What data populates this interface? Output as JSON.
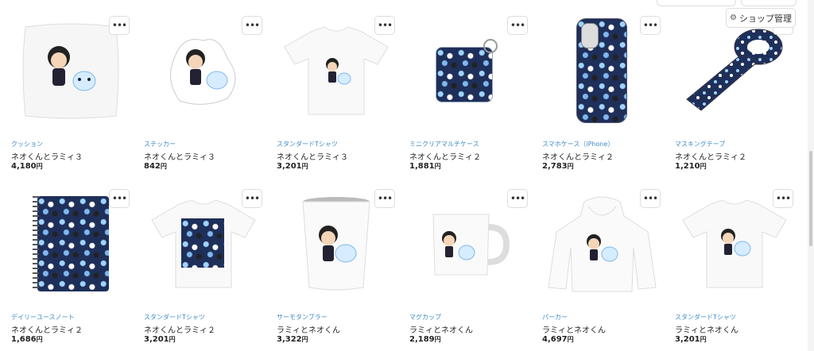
{
  "header": {
    "shop_manage_label": "ショップ管理",
    "shop_manage_icon": "gear-icon"
  },
  "products": [
    {
      "category": "クッション",
      "name": "ネオくんとラミィ３",
      "price": "4,180",
      "currency": "円"
    },
    {
      "category": "ステッカー",
      "name": "ネオくんとラミィ３",
      "price": "842",
      "currency": "円"
    },
    {
      "category": "スタンダードTシャツ",
      "name": "ネオくんとラミィ３",
      "price": "3,201",
      "currency": "円"
    },
    {
      "category": "ミニクリアマルチケース",
      "name": "ネオくんとラミィ２",
      "price": "1,881",
      "currency": "円"
    },
    {
      "category": "スマホケース（iPhone）",
      "name": "ネオくんとラミィ２",
      "price": "2,783",
      "currency": "円"
    },
    {
      "category": "マスキングテープ",
      "name": "ネオくんとラミィ２",
      "price": "1,210",
      "currency": "円"
    },
    {
      "category": "デイリーユースノート",
      "name": "ネオくんとラミィ２",
      "price": "1,686",
      "currency": "円"
    },
    {
      "category": "スタンダードTシャツ",
      "name": "ネオくんとラミィ２",
      "price": "3,201",
      "currency": "円"
    },
    {
      "category": "サーモタンブラー",
      "name": "ラミィとネオくん",
      "price": "3,322",
      "currency": "円"
    },
    {
      "category": "マグカップ",
      "name": "ラミィとネオくん",
      "price": "2,189",
      "currency": "円"
    },
    {
      "category": "パーカー",
      "name": "ラミィとネオくん",
      "price": "4,697",
      "currency": "円"
    },
    {
      "category": "スタンダードTシャツ",
      "name": "ラミィとネオくん",
      "price": "3,201",
      "currency": "円"
    }
  ],
  "more_button_label": "•••"
}
